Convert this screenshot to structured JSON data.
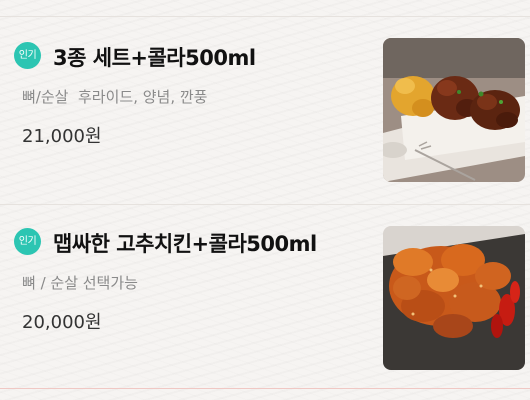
{
  "menu": {
    "items": [
      {
        "badge": "인기",
        "title": "3종 세트+콜라500ml",
        "description": "뼈/순살  후라이드, 양념, 깐풍",
        "price": "21,000원",
        "image_icon": "chicken-set-photo"
      },
      {
        "badge": "인기",
        "title": "맵싸한 고추치킨+콜라500ml",
        "description": "뼈 / 순살 선택가능",
        "price": "20,000원",
        "image_icon": "spicy-pepper-chicken-photo"
      }
    ]
  }
}
